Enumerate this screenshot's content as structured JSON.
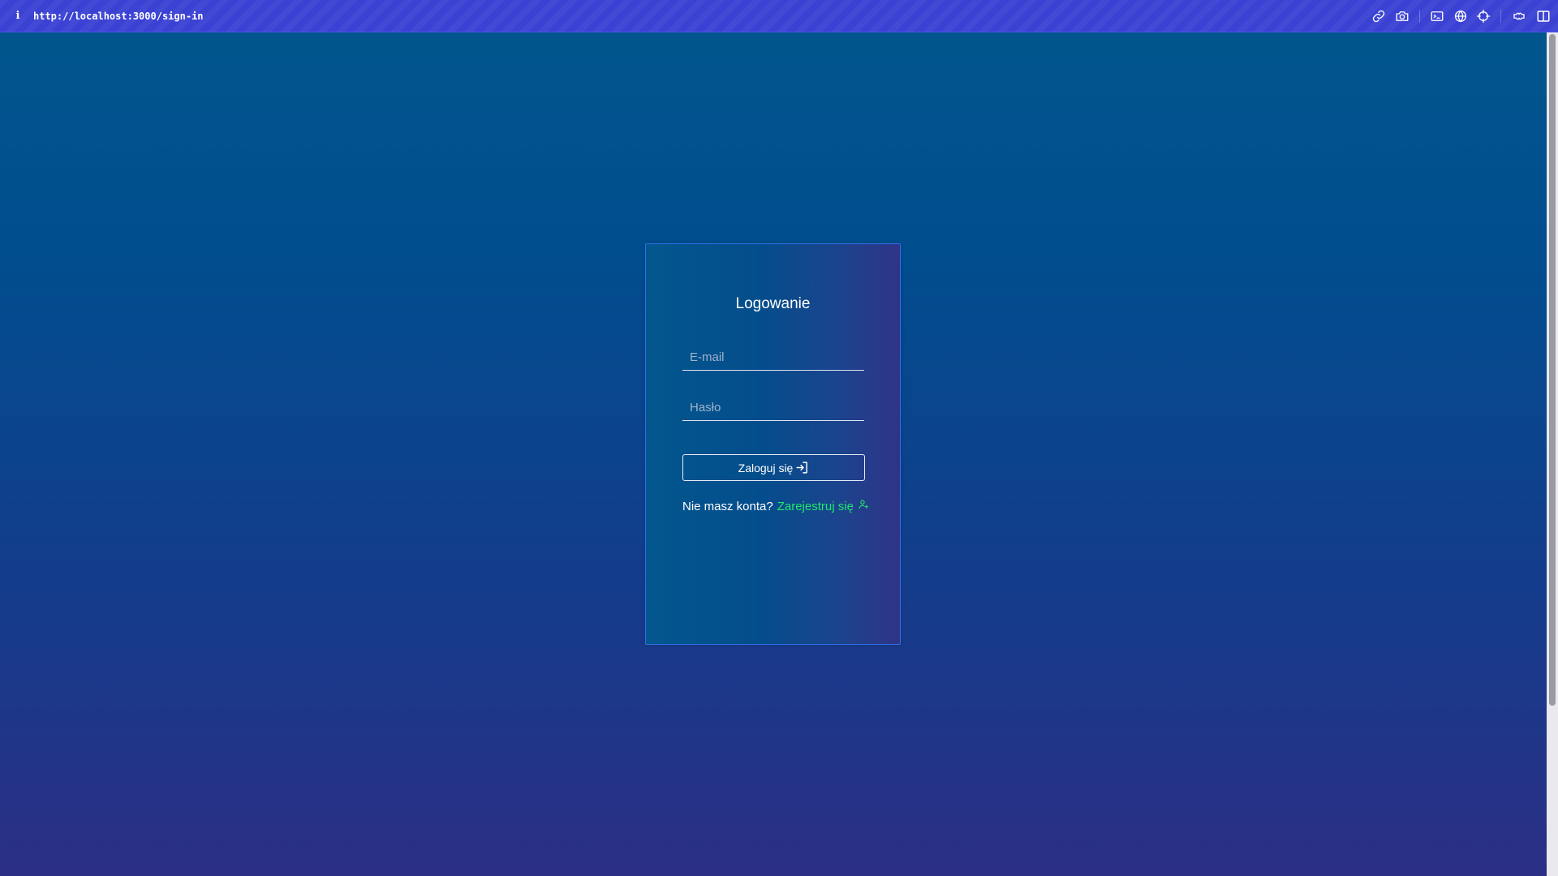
{
  "browser": {
    "info_glyph": "i",
    "url": "http://localhost:3000/sign-in",
    "toolbar_icons": [
      "link-icon",
      "camera-icon",
      "terminal-icon",
      "globe-icon",
      "crosshair-icon",
      "extension-icon",
      "split-view-icon"
    ]
  },
  "login": {
    "title": "Logowanie",
    "email_placeholder": "E-mail",
    "email_value": "",
    "password_placeholder": "Hasło",
    "password_value": "",
    "submit_label": "Zaloguj się",
    "submit_icon": "sign-in-icon",
    "signup_prompt": "Nie masz konta?",
    "signup_link": "Zarejestruj się",
    "signup_icon": "user-plus-icon"
  },
  "colors": {
    "topbar": "#3a41d3",
    "background_top": "#01578d",
    "background_bottom": "#2b2f85",
    "card_border": "#2f6fe8",
    "link": "#1ee86a",
    "text": "#ffffff"
  }
}
